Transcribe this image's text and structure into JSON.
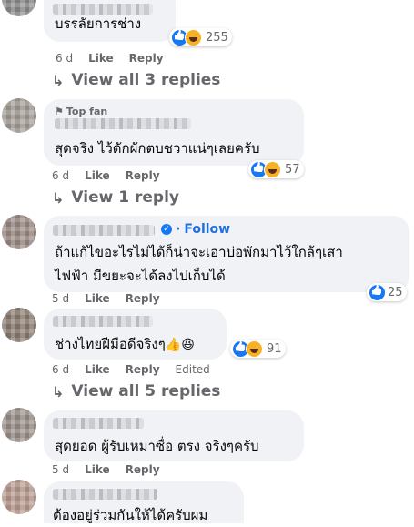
{
  "comments": [
    {
      "text_lines": [
        "บรรลัยการช่าง"
      ],
      "time": "6 d",
      "like": "Like",
      "reply": "Reply",
      "reactions": "255",
      "view_replies": "View all 3 replies"
    },
    {
      "badge": "Top fan",
      "text_lines": [
        "สุดจริง ไว้ดักผักตบชวาแน่ๆเลยครับ"
      ],
      "time": "6 d",
      "like": "Like",
      "reply": "Reply",
      "reactions": "57",
      "view_replies": "View 1 reply"
    },
    {
      "follow": "Follow",
      "text_lines": [
        "ถ้าแก้ไขอะไรไม่ได้ก็น่าจะเอาบ่อพักมาไว้ใกล้ๆเสา",
        "ไฟฟ้า มีขยะจะได้ลงไปเก็บได้"
      ],
      "time": "5 d",
      "like": "Like",
      "reply": "Reply",
      "reactions": "25"
    },
    {
      "text_lines": [
        "ช่างไทยฝีมือดีจริงๆ"
      ],
      "text_emojis": "👍😆",
      "time": "6 d",
      "like": "Like",
      "reply": "Reply",
      "edited": "Edited",
      "reactions": "91",
      "view_replies": "View all 5 replies"
    },
    {
      "text_lines": [
        "สุดยอด ผู้รับเหมาซื่อ ตรง จริงๆครับ"
      ],
      "time": "5 d",
      "like": "Like",
      "reply": "Reply"
    },
    {
      "text_lines": [
        "ต้องอยู่ร่วมกันให้ได้ครับผม"
      ]
    }
  ],
  "colors": {
    "bubble": "#f0f2f5",
    "meta_text": "#65676b",
    "link_blue": "#216fdb",
    "like_blue": "#1877f2",
    "haha_yellow": "#f7b125"
  },
  "icons": [
    "reply-arrow-icon",
    "verified-badge-icon",
    "top-fan-icon",
    "like-reaction-icon",
    "haha-reaction-icon"
  ]
}
